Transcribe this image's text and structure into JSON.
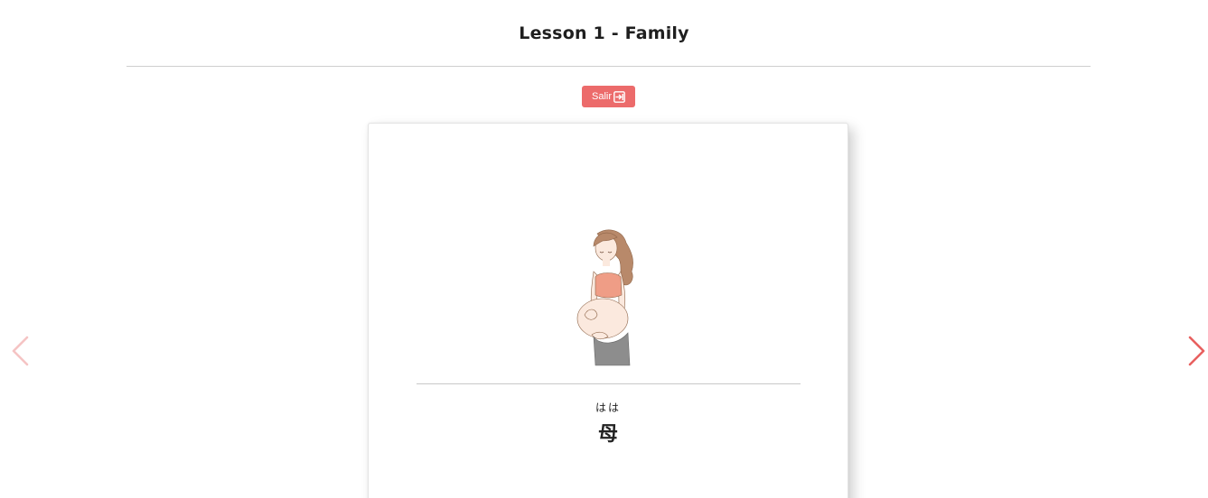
{
  "header": {
    "title": "Lesson 1 - Family"
  },
  "toolbar": {
    "exit_label": "Salir",
    "exit_icon": "sign-out-icon"
  },
  "card": {
    "reading": "はは",
    "kanji": "母",
    "image_icon": "pregnant-woman-illustration"
  },
  "navigation": {
    "prev_icon": "chevron-left-icon",
    "next_icon": "chevron-right-icon",
    "prev_color": "#f5c4c4",
    "next_color": "#e8605f"
  },
  "colors": {
    "accent": "#ec6b6b"
  }
}
